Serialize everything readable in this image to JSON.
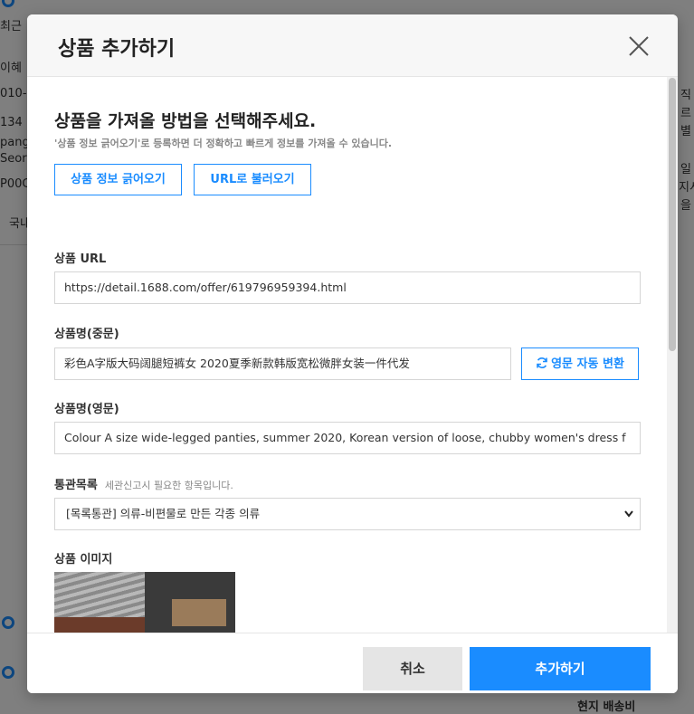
{
  "background": {
    "fragments": [
      "최근",
      "이혜",
      "010-",
      "134",
      "pang",
      "Seor",
      "P00C",
      "국내",
      "직",
      "르",
      "별",
      "일",
      "지시",
      "을",
      "현지 배송비"
    ]
  },
  "modal": {
    "title": "상품 추가하기",
    "heading": "상품을 가져올 방법을 선택해주세요.",
    "subtext": "'상품 정보 긁어오기'로 등록하면 더 정확하고 빠르게 정보를 가져올 수 있습니다.",
    "buttons": {
      "scrape": "상품 정보 긁어오기",
      "url_load": "URL로 불러오기",
      "convert": "영문 자동 변환",
      "cancel": "취소",
      "submit": "추가하기"
    },
    "fields": {
      "url": {
        "label": "상품 URL",
        "value": "https://detail.1688.com/offer/619796959394.html"
      },
      "name_cn": {
        "label": "상품명(중문)",
        "value": "彩色A字版大码阔腿短裤女 2020夏季新款韩版宽松微胖女装一件代发"
      },
      "name_en": {
        "label": "상품명(영문)",
        "value": "Colour A size wide-legged panties, summer 2020, Korean version of loose, chubby women's dress f"
      },
      "customs": {
        "label": "통관목록",
        "hint": "세관신고시 필요한 항목입니다.",
        "selected": "[목록통관] 의류-비편물로 만든 각종 의류"
      },
      "image": {
        "label": "상품 이미지"
      }
    }
  },
  "colors": {
    "accent": "#1a8cff",
    "cancel_bg": "#e5e5e5"
  },
  "icons": {
    "close": "close-icon",
    "refresh": "refresh-icon",
    "chevron": "chevron-down-icon"
  }
}
